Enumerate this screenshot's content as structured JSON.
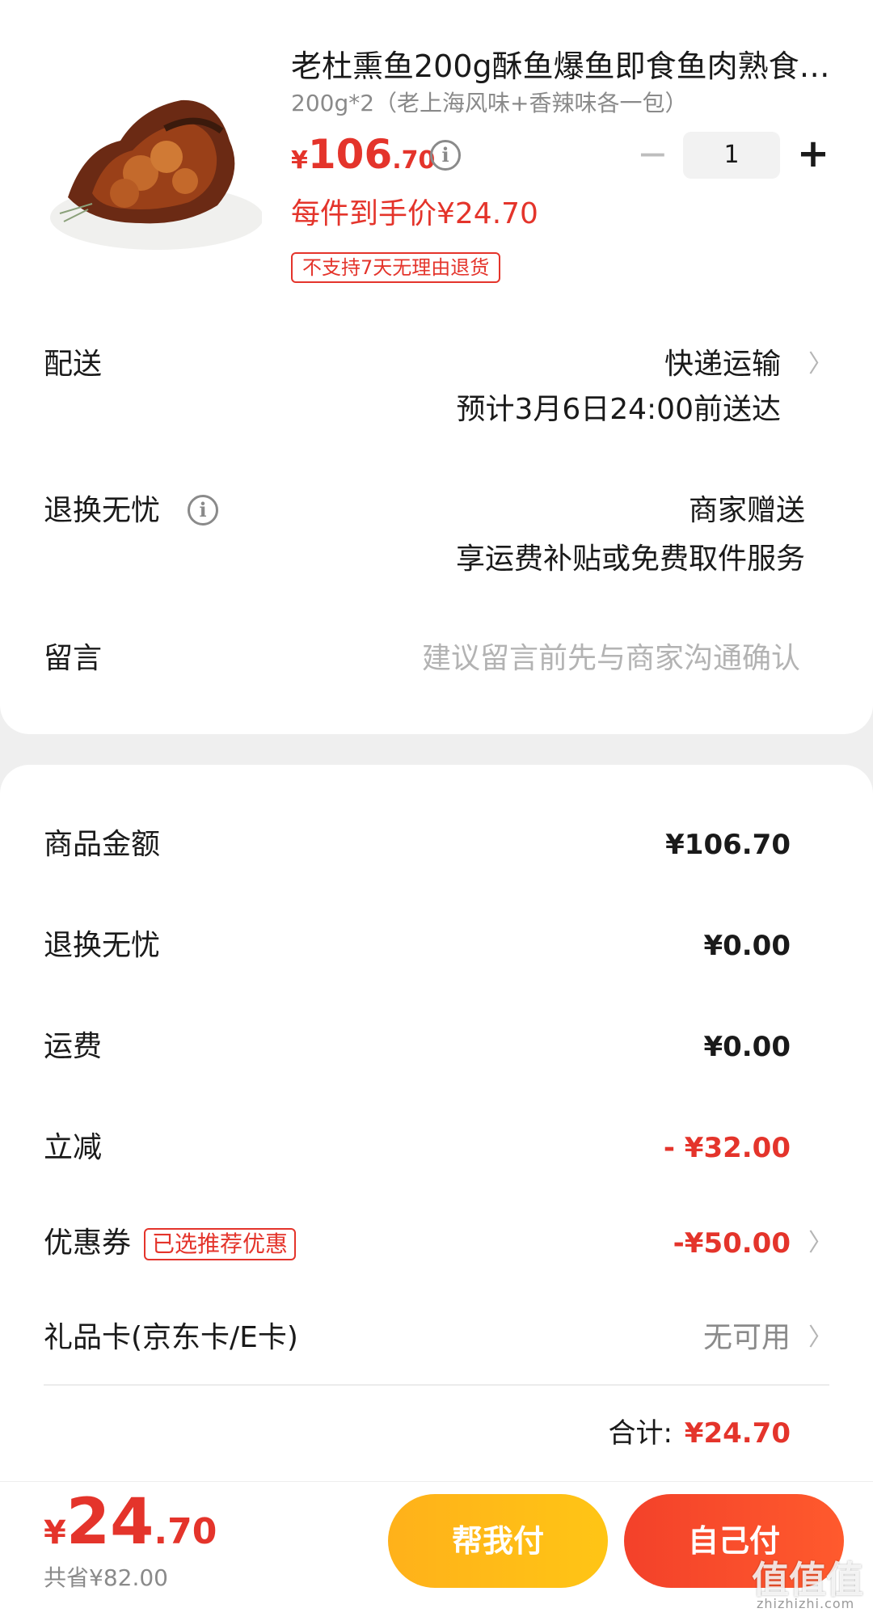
{
  "product": {
    "image_icon": "smoked-fish-photo",
    "title": "老杜熏鱼200g酥鱼爆鱼即食鱼肉熟食…",
    "spec": "200g*2（老上海风味+香辣味各一包）",
    "price_currency": "¥",
    "price_int": "106",
    "price_dec": ".70",
    "info_icon": "info-icon",
    "quantity": "1",
    "minus_label": "−",
    "plus_label": "+",
    "unit_price_text": "每件到手价¥24.70",
    "no_return_tag": "不支持7天无理由退货"
  },
  "delivery": {
    "label": "配送",
    "method": "快递运输",
    "eta": "预计3月6日24:00前送达"
  },
  "return_service": {
    "label": "退换无忧",
    "value": "商家赠送",
    "desc": "享运费补贴或免费取件服务"
  },
  "message": {
    "label": "留言",
    "placeholder": "建议留言前先与商家沟通确认"
  },
  "summary": {
    "items": [
      {
        "label": "商品金额",
        "value": "¥106.70"
      },
      {
        "label": "退换无忧",
        "value": "¥0.00"
      },
      {
        "label": "运费",
        "value": "¥0.00"
      },
      {
        "label": "立减",
        "value": "- ¥32.00"
      },
      {
        "label": "优惠券",
        "tag": "已选推荐优惠",
        "value": "-¥50.00"
      },
      {
        "label": "礼品卡(京东卡/E卡)",
        "value": "无可用"
      }
    ],
    "total_label": "合计:",
    "total_value": "¥24.70"
  },
  "footer": {
    "currency": "¥",
    "total_int": "24",
    "total_dec": ".70",
    "saved": "共省¥82.00",
    "help_pay": "帮我付",
    "self_pay": "自己付"
  },
  "watermark": {
    "text": "值值值",
    "sub": "zhizhizhi.com"
  },
  "colors": {
    "accent_red": "#e4342b",
    "button_yellow": "#ffb11a",
    "button_red": "#f3412a"
  }
}
